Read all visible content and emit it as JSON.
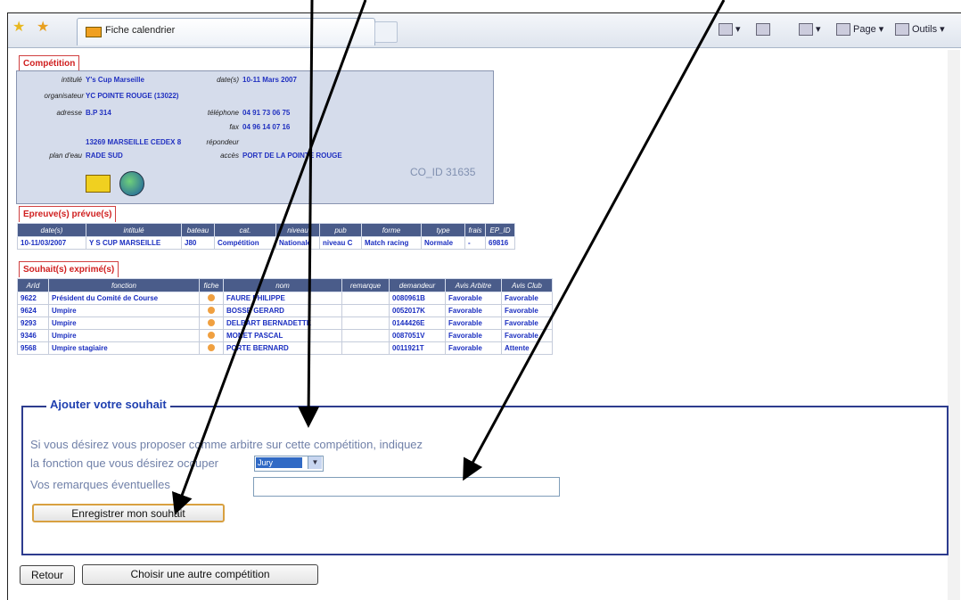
{
  "browser": {
    "tab_title": "Fiche calendrier",
    "toolbar": {
      "page_label": "Page",
      "tools_label": "Outils"
    }
  },
  "competition": {
    "tab_label": "Compétition",
    "labels": {
      "title": "intitulé",
      "organizer": "organisateur",
      "address": "adresse",
      "water": "plan d'eau",
      "dates": "date(s)",
      "phone": "téléphone",
      "fax": "fax",
      "answering": "répondeur",
      "access": "accès"
    },
    "values": {
      "title": "Y's Cup Marseille",
      "organizer": "YC POINTE ROUGE (13022)",
      "address": "B.P 314",
      "city": "13269 MARSEILLE CEDEX 8",
      "water": "RADE SUD",
      "dates": "10-11 Mars 2007",
      "phone": "04 91 73 06 75",
      "fax": "04 96 14 07 16",
      "access": "PORT DE LA POINTE ROUGE"
    },
    "co_id": "CO_ID 31635"
  },
  "events": {
    "tab_label": "Epreuve(s) prévue(s)",
    "headers": [
      "date(s)",
      "intitulé",
      "bateau",
      "cat.",
      "niveau",
      "pub",
      "forme",
      "type",
      "frais",
      "EP_ID"
    ],
    "rows": [
      [
        "10-11/03/2007",
        "Y S CUP MARSEILLE",
        "J80",
        "Compétition",
        "Nationale",
        "niveau C",
        "Match racing",
        "Normale",
        "-",
        "69816"
      ]
    ]
  },
  "wishes": {
    "tab_label": "Souhait(s) exprimé(s)",
    "headers": [
      "ArId",
      "fonction",
      "fiche",
      "nom",
      "remarque",
      "demandeur",
      "Avis Arbitre",
      "Avis Club"
    ],
    "rows": [
      [
        "9622",
        "Président du Comité de Course",
        "",
        "FAURE PHILIPPE",
        "",
        "0080961B",
        "Favorable",
        "Favorable"
      ],
      [
        "9624",
        "Umpire",
        "",
        "BOSSE GERARD",
        "",
        "0052017K",
        "Favorable",
        "Favorable"
      ],
      [
        "9293",
        "Umpire",
        "",
        "DELBART BERNADETTE",
        "",
        "0144426E",
        "Favorable",
        "Favorable"
      ],
      [
        "9346",
        "Umpire",
        "",
        "MONET PASCAL",
        "",
        "0087051V",
        "Favorable",
        "Favorable"
      ],
      [
        "9568",
        "Umpire stagiaire",
        "",
        "PORTE BERNARD",
        "",
        "0011921T",
        "Favorable",
        "Attente"
      ]
    ]
  },
  "form": {
    "legend": "Ajouter votre souhait",
    "line1": "Si vous désirez vous proposer comme arbitre sur cette compétition, indiquez",
    "line2": "la fonction que vous désirez occuper",
    "select_value": "Jury",
    "remarks_label": "Vos remarques éventuelles",
    "remarks_value": "",
    "save_button": "Enregistrer mon souhait"
  },
  "nav": {
    "back_button": "Retour",
    "choose_button": "Choisir une autre compétition"
  }
}
